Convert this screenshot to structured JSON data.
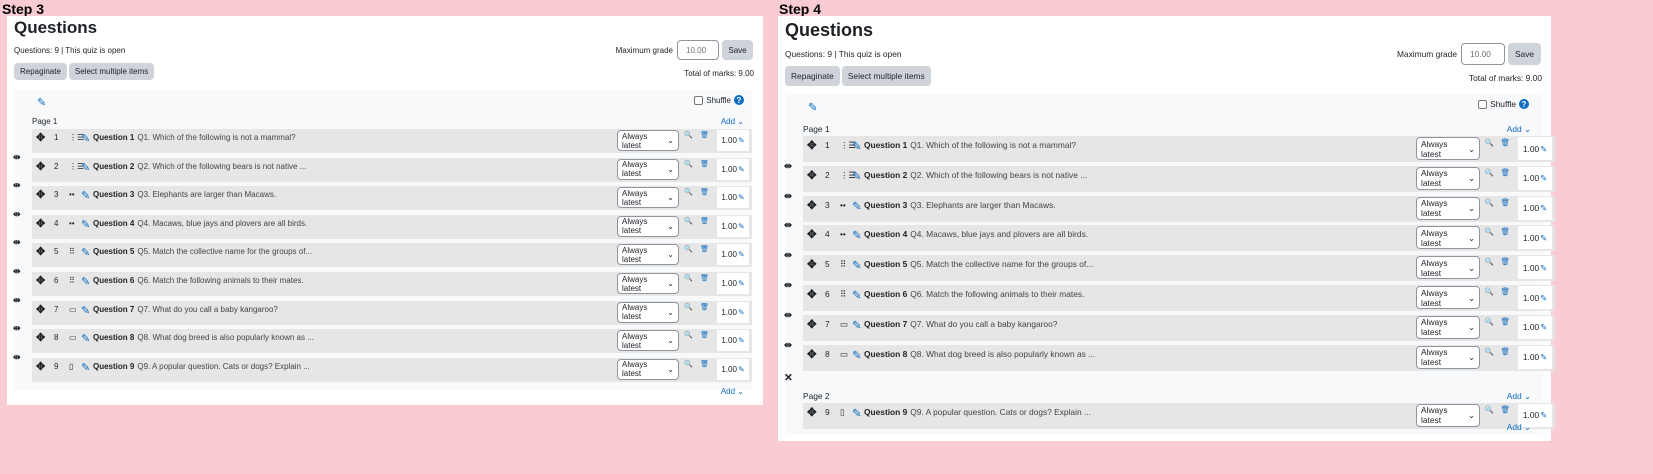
{
  "steps": [
    {
      "label": "Step 3",
      "title": "Questions",
      "status": "Questions: 9 | This quiz is open",
      "max_grade_label": "Maximum grade",
      "max_grade_value": "10.00",
      "save_label": "Save",
      "repaginate_label": "Repaginate",
      "select_multiple_label": "Select multiple items",
      "total_marks": "Total of marks: 9.00",
      "shuffle_label": "Shuffle",
      "help_glyph": "?",
      "pages": [
        {
          "label": "Page 1",
          "add_label": "Add ⌄",
          "questions": [
            0,
            1,
            2,
            3,
            4,
            5,
            6,
            7,
            8
          ]
        }
      ],
      "bottom_add_label": "Add ⌄"
    },
    {
      "label": "Step 4",
      "title": "Questions",
      "status": "Questions: 9 | This quiz is open",
      "max_grade_label": "Maximum grade",
      "max_grade_value": "10.00",
      "save_label": "Save",
      "repaginate_label": "Repaginate",
      "select_multiple_label": "Select multiple items",
      "total_marks": "Total of marks: 9.00",
      "shuffle_label": "Shuffle",
      "help_glyph": "?",
      "pages": [
        {
          "label": "Page 1",
          "add_label": "Add ⌄",
          "questions": [
            0,
            1,
            2,
            3,
            4,
            5,
            6,
            7
          ]
        },
        {
          "label": "Page 2",
          "add_label": "Add ⌄",
          "questions": [
            8
          ]
        }
      ],
      "bottom_add_label": "Add ⌄"
    }
  ],
  "questions": [
    {
      "number": "1",
      "icon": "multichoice-icon",
      "glyph": "⋮☰",
      "name": "Question 1",
      "text": "Q1. Which of the following is not a mammal?",
      "version": "Always latest",
      "mark": "1.00"
    },
    {
      "number": "2",
      "icon": "multichoice-icon",
      "glyph": "⋮☰",
      "name": "Question 2",
      "text": "Q2. Which of the following bears is not native ...",
      "version": "Always latest",
      "mark": "1.00"
    },
    {
      "number": "3",
      "icon": "truefalse-icon",
      "glyph": "••",
      "name": "Question 3",
      "text": "Q3. Elephants are larger than Macaws.",
      "version": "Always latest",
      "mark": "1.00"
    },
    {
      "number": "4",
      "icon": "truefalse-icon",
      "glyph": "••",
      "name": "Question 4",
      "text": "Q4. Macaws, blue jays and plovers are all birds.",
      "version": "Always latest",
      "mark": "1.00"
    },
    {
      "number": "5",
      "icon": "matching-icon",
      "glyph": "⠿",
      "name": "Question 5",
      "text": "Q5. Match the collective name for the groups of...",
      "version": "Always latest",
      "mark": "1.00"
    },
    {
      "number": "6",
      "icon": "matching-icon",
      "glyph": "⠿",
      "name": "Question 6",
      "text": "Q6. Match the following animals to their mates.",
      "version": "Always latest",
      "mark": "1.00"
    },
    {
      "number": "7",
      "icon": "shortanswer-icon",
      "glyph": "▭",
      "name": "Question 7",
      "text": "Q7. What do you call a baby kangaroo?",
      "version": "Always latest",
      "mark": "1.00"
    },
    {
      "number": "8",
      "icon": "shortanswer-icon",
      "glyph": "▭",
      "name": "Question 8",
      "text": "Q8. What dog breed is also popularly known as ...",
      "version": "Always latest",
      "mark": "1.00"
    },
    {
      "number": "9",
      "icon": "essay-icon",
      "glyph": "▯",
      "name": "Question 9",
      "text": "Q9. A popular question. Cats or dogs? Explain ...",
      "version": "Always latest",
      "mark": "1.00"
    }
  ],
  "icons": {
    "move": "✥",
    "pencil": "✎",
    "magnifier": "🔍",
    "trash": "🗑",
    "pagebreak": "⇹",
    "unjoin": "✕",
    "select_caret": "⌄"
  },
  "colors": {
    "background": "#f9ccd3",
    "link": "#0f6cbf",
    "slot": "#e6e6e6",
    "button": "#ced4da"
  }
}
